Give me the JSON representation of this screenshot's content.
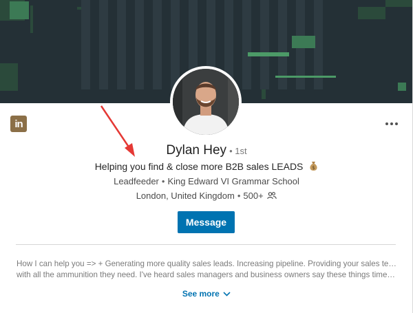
{
  "profile": {
    "name": "Dylan Hey",
    "degree": "• 1st",
    "headline": "Helping you find & close more B2B sales LEADS",
    "headline_icon": "money-bag-icon",
    "company": "Leadfeeder",
    "school": "King Edward VI Grammar School",
    "location": "London, United Kingdom",
    "connections": "500+",
    "separator": "•"
  },
  "actions": {
    "message_label": "Message",
    "see_more_label": "See more"
  },
  "summary": {
    "line1": "How I can help you => + Generating more quality sales leads. Increasing pipeline. Providing your sales team",
    "line2": "with all the ammunition they need. I've heard sales managers and business owners say these things time and time…"
  },
  "brand": {
    "logo_text": "in",
    "accent_color": "#0073b1",
    "logo_color": "#8b6f47",
    "banner_color": "#243036",
    "arrow_color": "#e53935"
  }
}
